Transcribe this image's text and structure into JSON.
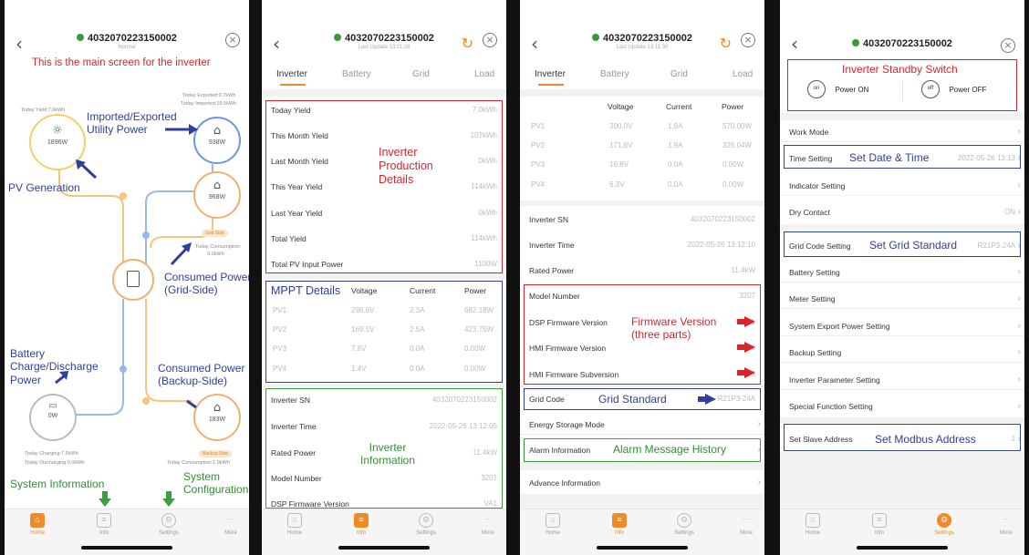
{
  "serial": "40320702231500​02",
  "nav": {
    "home": "Home",
    "info": "Info",
    "settings": "Settings",
    "more": "More"
  },
  "colors": {
    "accent": "#f08a24",
    "online": "#3a9a3a",
    "red_ann": "#d6262c",
    "blue_ann": "#2f3f9a",
    "green_ann": "#38a03c"
  },
  "panel1": {
    "status": "Normal",
    "caption": "This is the main screen for the inverter",
    "pv_value": "1896W",
    "grid_value": "938W",
    "grid_side_value": "968W",
    "backup_value": "183W",
    "battery_value": "0W",
    "today_yield": "Today Yield:7.0kWh",
    "today_exported": "Today Exported:0.7kWh",
    "today_imported": "Today Imported:18.5kWh",
    "today_consumption": "Today Consumption:",
    "today_consumption_value": "0.0kWh",
    "grid_side_tag": "Grid Side",
    "backup_side_tag": "Backup Side",
    "today_charging": "Today Charging:7.5kWh",
    "today_discharging": "Today Discharging:0.0kWh",
    "today_consumption2": "Today Consumption:1.9kWh",
    "ann_imported": "Imported/Exported\nUtility Power",
    "ann_pv": "PV Generation",
    "ann_consumed_grid": "Consumed Power\n(Grid-Side)",
    "ann_battery": "Battery\nCharge/Discharge\nPower",
    "ann_consumed_backup": "Consumed Power\n(Backup-Side)",
    "ann_sysinfo": "System Information",
    "ann_sysconf": "System\nConfiguration"
  },
  "panel2": {
    "update": "Last Update:13:11:28",
    "tabs": [
      "Inverter",
      "Battery",
      "Grid",
      "Load"
    ],
    "yield_rows": [
      {
        "label": "Today Yield",
        "value": "7.0kWh"
      },
      {
        "label": "This Month Yield",
        "value": "107kWh"
      },
      {
        "label": "Last Month Yield",
        "value": "0kWh"
      },
      {
        "label": "This Year Yield",
        "value": "114kWh"
      },
      {
        "label": "Last Year Yield",
        "value": "0kWh"
      },
      {
        "label": "Total Yield",
        "value": "114kWh"
      },
      {
        "label": "Total PV Input Power",
        "value": "1100W"
      }
    ],
    "ann_production": "Inverter\nProduction\nDetails",
    "ann_mppt": "MPPT Details",
    "mppt_headers": [
      "Voltage",
      "Current",
      "Power"
    ],
    "mppt_rows": [
      {
        "name": "PV1",
        "v": "296.6V",
        "c": "2.3A",
        "p": "682.18W"
      },
      {
        "name": "PV2",
        "v": "169.5V",
        "c": "2.5A",
        "p": "423.75W"
      },
      {
        "name": "PV3",
        "v": "7.8V",
        "c": "0.0A",
        "p": "0.00W"
      },
      {
        "name": "PV4",
        "v": "1.4V",
        "c": "0.0A",
        "p": "0.00W"
      }
    ],
    "info_rows": [
      {
        "label": "Inverter SN",
        "value": "40320702231500​02"
      },
      {
        "label": "Inverter Time",
        "value": "2022-05-26 13:12:05"
      },
      {
        "label": "Rated Power",
        "value": "11.4kW"
      },
      {
        "label": "Model Number",
        "value": "3207"
      },
      {
        "label": "DSP Firmware Version",
        "value": "VA1"
      }
    ],
    "ann_info": "Inverter\nInformation"
  },
  "panel3": {
    "update": "Last Update:13:11:30",
    "tabs": [
      "Inverter",
      "Battery",
      "Grid",
      "Load"
    ],
    "pv_headers": [
      "Voltage",
      "Current",
      "Power"
    ],
    "pv_rows": [
      {
        "name": "PV1",
        "v": "300.0V",
        "c": "1.9A",
        "p": "570.00W"
      },
      {
        "name": "PV2",
        "v": "171.6V",
        "c": "1.9A",
        "p": "326.04W"
      },
      {
        "name": "PV3",
        "v": "16.8V",
        "c": "0.0A",
        "p": "0.00W"
      },
      {
        "name": "PV4",
        "v": "6.3V",
        "c": "0.0A",
        "p": "0.00W"
      }
    ],
    "rows": [
      {
        "label": "Inverter SN",
        "value": "40320702231500​02"
      },
      {
        "label": "Inverter Time",
        "value": "2022-05-26 13:12:10"
      },
      {
        "label": "Rated Power",
        "value": "11.4kW"
      },
      {
        "label": "Model Number",
        "value": "3207"
      },
      {
        "label": "DSP Firmware Version",
        "value": "VA1"
      },
      {
        "label": "HMI Firmware Version",
        "value": "VB0"
      },
      {
        "label": "HMI Firmware Subversion",
        "value": "V5"
      },
      {
        "label": "Grid Code",
        "value": "R21P3-24A"
      },
      {
        "label": "Energy Storage Mode",
        "value": ""
      },
      {
        "label": "Alarm Information",
        "value": ""
      },
      {
        "label": "Advance Information",
        "value": ""
      }
    ],
    "ann_firmware": "Firmware Version\n(three parts)",
    "ann_grid": "Grid Standard",
    "ann_alarm": "Alarm Message History"
  },
  "panel4": {
    "ann_standby": "Inverter Standby Switch",
    "power_on": "Power ON",
    "power_off": "Power OFF",
    "on": "on",
    "off": "off",
    "rows": [
      {
        "label": "Work Mode",
        "value": ""
      },
      {
        "label": "Time Setting",
        "value": "2022-05-26 13:13"
      },
      {
        "label": "Indicator Setting",
        "value": ""
      },
      {
        "label": "Dry Contact",
        "value": "ON"
      },
      {
        "label": "Grid Code Setting",
        "value": "R21P3-24A"
      },
      {
        "label": "Battery Setting",
        "value": ""
      },
      {
        "label": "Meter Setting",
        "value": ""
      },
      {
        "label": "System Export Power Setting",
        "value": ""
      },
      {
        "label": "Backup Setting",
        "value": ""
      },
      {
        "label": "Inverter Parameter Setting",
        "value": ""
      },
      {
        "label": "Special Function Setting",
        "value": ""
      },
      {
        "label": "Set Slave Address",
        "value": "1"
      }
    ],
    "ann_time": "Set Date & Time",
    "ann_grid": "Set Grid Standard",
    "ann_modbus": "Set Modbus Address"
  }
}
